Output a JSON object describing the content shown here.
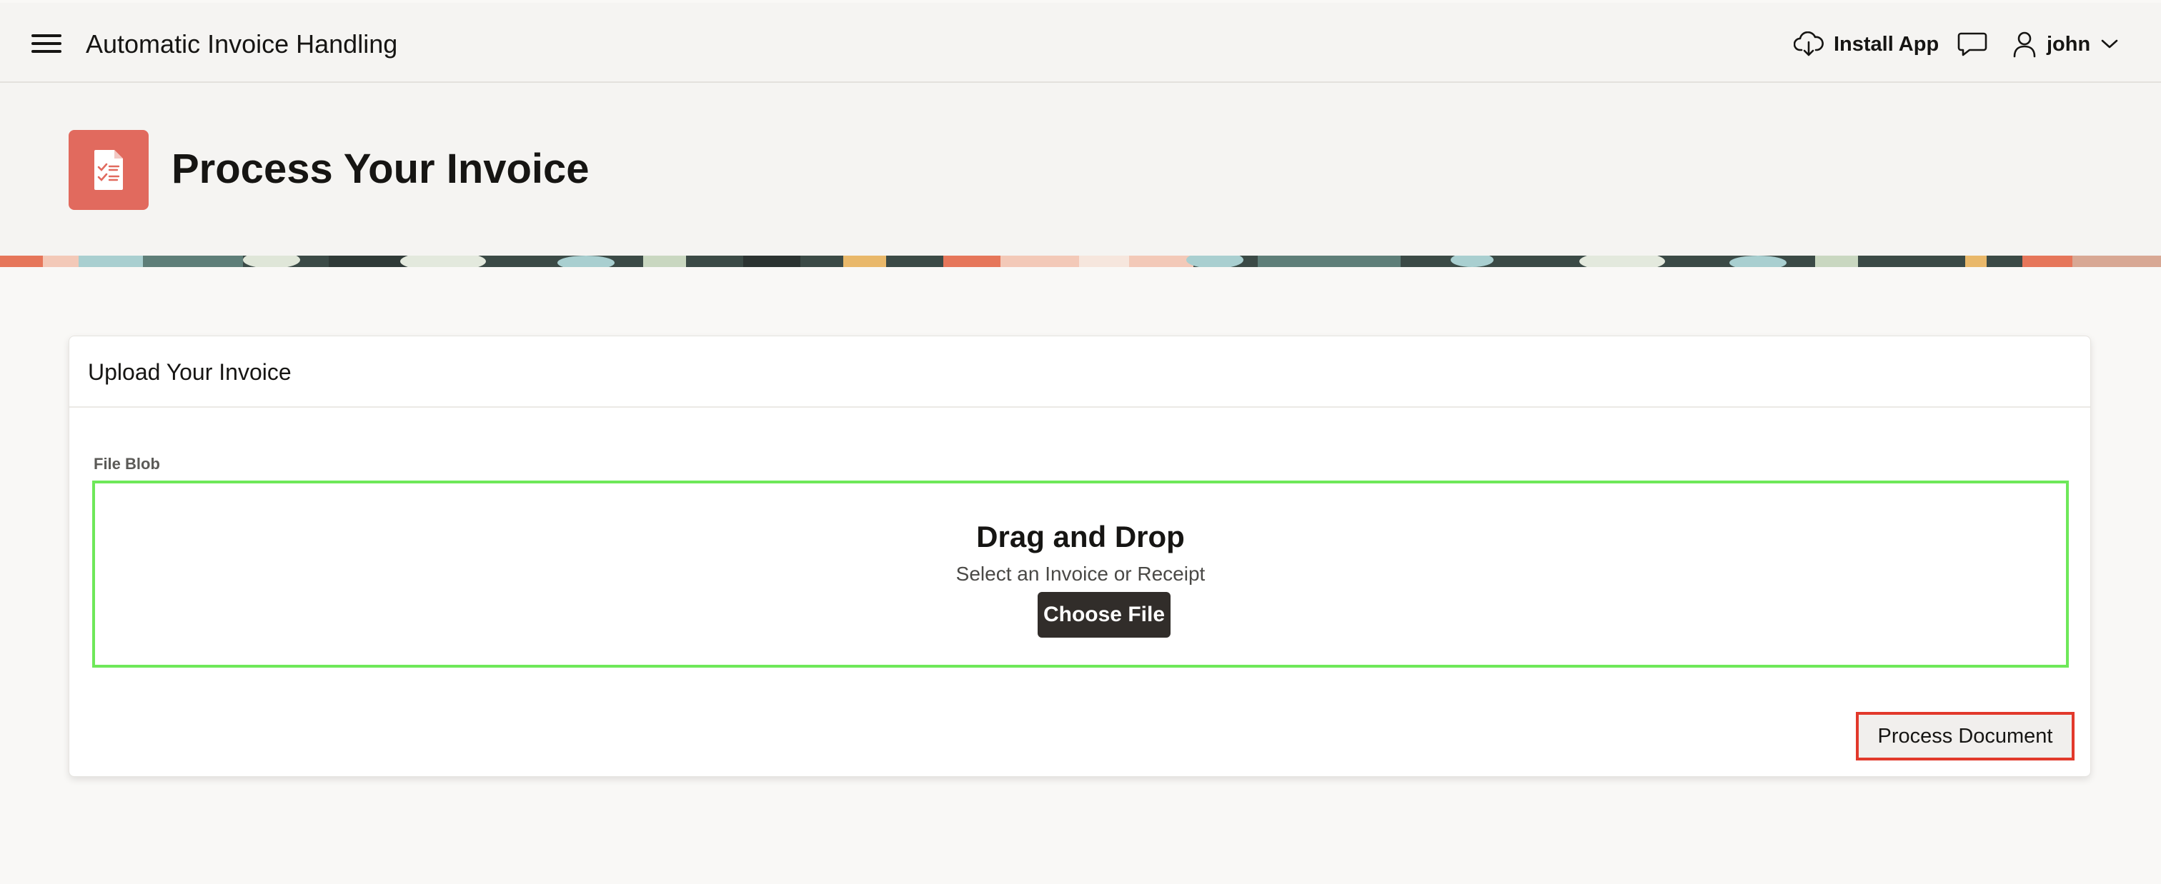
{
  "header": {
    "app_title": "Automatic Invoice Handling",
    "menu_icon": "hamburger-menu-icon",
    "install_label": "Install App",
    "install_icon": "cloud-download-icon",
    "chat_icon": "chat-bubble-icon",
    "user_icon": "user-icon",
    "user_name": "john",
    "user_chevron": "chevron-down-icon"
  },
  "hero": {
    "icon": "invoice-checklist-icon",
    "icon_color": "#e16a5e",
    "title": "Process Your Invoice"
  },
  "region": {
    "title": "Upload Your Invoice",
    "field_label": "File Blob",
    "dropzone": {
      "heading": "Drag and Drop",
      "subtext": "Select an Invoice or Receipt",
      "button_label": "Choose File",
      "highlight_color": "#6ee859"
    },
    "process_button_label": "Process Document",
    "process_highlight_color": "#e2392b"
  }
}
